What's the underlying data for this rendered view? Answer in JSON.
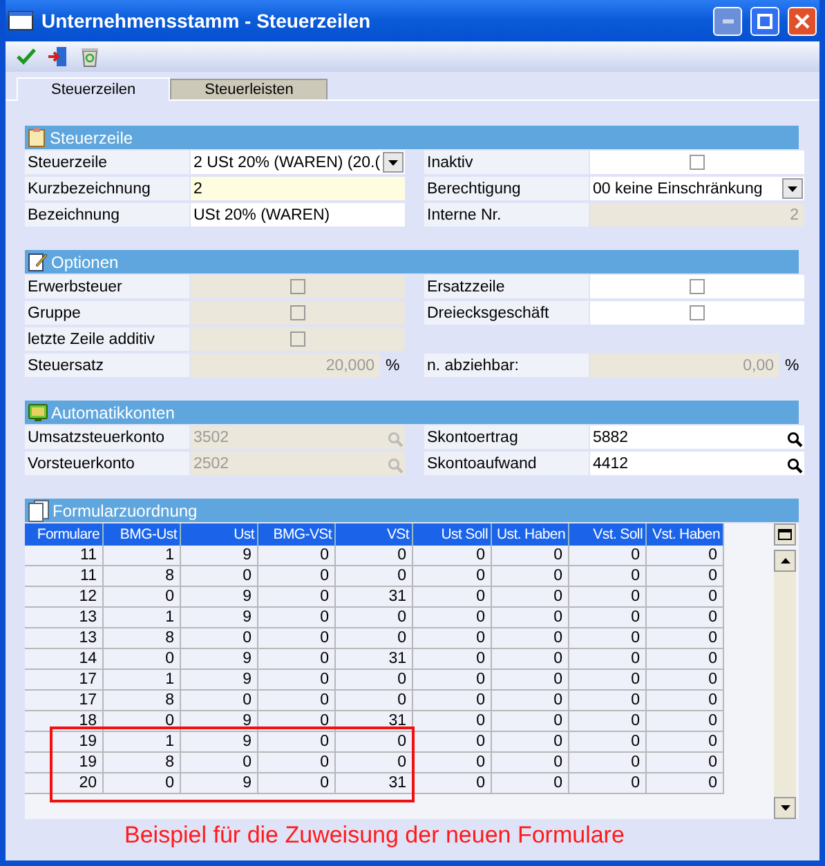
{
  "window": {
    "title": "Unternehmensstamm - Steuerzeilen"
  },
  "tabs": [
    {
      "label": "Steuerzeilen",
      "selected": true
    },
    {
      "label": "Steuerleisten",
      "selected": false
    }
  ],
  "sections": [
    {
      "title": "Steuerzeile",
      "rows": [
        {
          "left": {
            "label": "Steuerzeile",
            "kind": "select",
            "value": "2   USt 20% (WAREN) (20.(",
            "disabled": false
          },
          "right": {
            "label": "Inaktiv",
            "kind": "checkbox",
            "checked": false,
            "disabled": false
          }
        },
        {
          "left": {
            "label": "Kurzbezeichnung",
            "kind": "text",
            "value": "2",
            "focused": true,
            "disabled": false
          },
          "right": {
            "label": "Berechtigung",
            "kind": "select",
            "value": "00 keine Einschränkung",
            "disabled": false
          }
        },
        {
          "left": {
            "label": "Bezeichnung",
            "kind": "text",
            "value": "USt 20% (WAREN)",
            "focused": false,
            "disabled": false
          },
          "right": {
            "label": "Interne Nr.",
            "kind": "number",
            "value": "2",
            "disabled": true
          }
        }
      ]
    },
    {
      "title": "Optionen",
      "rows": [
        {
          "left": {
            "label": "Erwerbsteuer",
            "kind": "checkbox",
            "checked": false,
            "disabled": true
          },
          "right": {
            "label": "Ersatzzeile",
            "kind": "checkbox",
            "checked": false,
            "disabled": false
          }
        },
        {
          "left": {
            "label": "Gruppe",
            "kind": "checkbox",
            "checked": false,
            "disabled": true
          },
          "right": {
            "label": "Dreiecksgeschäft",
            "kind": "checkbox",
            "checked": false,
            "disabled": false
          }
        },
        {
          "left": {
            "label": "letzte Zeile additiv",
            "kind": "checkbox",
            "checked": false,
            "disabled": true
          }
        },
        {
          "left": {
            "label": "Steuersatz",
            "kind": "number",
            "value": "20,000",
            "unit": "%",
            "disabled": true
          },
          "right": {
            "label": "n. abziehbar:",
            "kind": "number",
            "value": "0,00",
            "unit": "%",
            "disabled": true
          }
        }
      ]
    },
    {
      "title": "Automatikkonten",
      "rows": [
        {
          "left": {
            "label": "Umsatzsteuerkonto",
            "kind": "lookup",
            "value": "3502",
            "disabled": true
          },
          "right": {
            "label": "Skontoertrag",
            "kind": "lookup",
            "value": "5882",
            "disabled": false
          }
        },
        {
          "left": {
            "label": "Vorsteuerkonto",
            "kind": "lookup",
            "value": "2502",
            "disabled": true
          },
          "right": {
            "label": "Skontoaufwand",
            "kind": "lookup",
            "value": "4412",
            "disabled": false
          }
        }
      ]
    }
  ],
  "formulare": {
    "title": "Formularzuordnung",
    "columns": [
      "Formulare",
      "BMG-Ust",
      "Ust",
      "BMG-VSt",
      "VSt",
      "Ust Soll",
      "Ust. Haben",
      "Vst. Soll",
      "Vst. Haben"
    ],
    "rows": [
      {
        "cells": [
          "11",
          "1",
          "9",
          "0",
          "0",
          "0",
          "0",
          "0",
          "0"
        ],
        "highlighted": false
      },
      {
        "cells": [
          "11",
          "8",
          "0",
          "0",
          "0",
          "0",
          "0",
          "0",
          "0"
        ],
        "highlighted": false
      },
      {
        "cells": [
          "12",
          "0",
          "9",
          "0",
          "31",
          "0",
          "0",
          "0",
          "0"
        ],
        "highlighted": false
      },
      {
        "cells": [
          "13",
          "1",
          "9",
          "0",
          "0",
          "0",
          "0",
          "0",
          "0"
        ],
        "highlighted": false
      },
      {
        "cells": [
          "13",
          "8",
          "0",
          "0",
          "0",
          "0",
          "0",
          "0",
          "0"
        ],
        "highlighted": false
      },
      {
        "cells": [
          "14",
          "0",
          "9",
          "0",
          "31",
          "0",
          "0",
          "0",
          "0"
        ],
        "highlighted": false
      },
      {
        "cells": [
          "17",
          "1",
          "9",
          "0",
          "0",
          "0",
          "0",
          "0",
          "0"
        ],
        "highlighted": false
      },
      {
        "cells": [
          "17",
          "8",
          "0",
          "0",
          "0",
          "0",
          "0",
          "0",
          "0"
        ],
        "highlighted": false
      },
      {
        "cells": [
          "18",
          "0",
          "9",
          "0",
          "31",
          "0",
          "0",
          "0",
          "0"
        ],
        "highlighted": false
      },
      {
        "cells": [
          "19",
          "1",
          "9",
          "0",
          "0",
          "0",
          "0",
          "0",
          "0"
        ],
        "highlighted": true
      },
      {
        "cells": [
          "19",
          "8",
          "0",
          "0",
          "0",
          "0",
          "0",
          "0",
          "0"
        ],
        "highlighted": true
      },
      {
        "cells": [
          "20",
          "0",
          "9",
          "0",
          "31",
          "0",
          "0",
          "0",
          "0"
        ],
        "highlighted": true
      }
    ],
    "annotation": "Beispiel für die Zuweisung der neuen Formulare"
  }
}
